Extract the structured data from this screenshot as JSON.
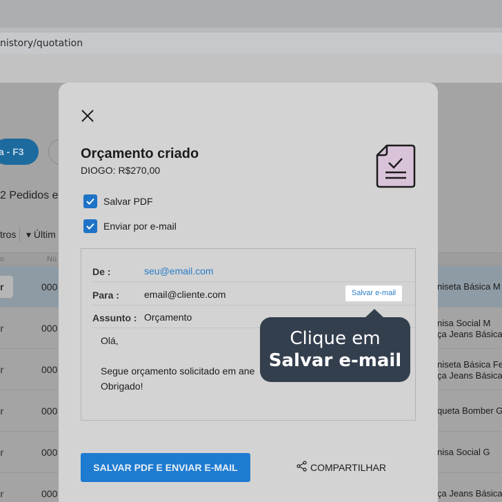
{
  "browser": {
    "url_fragment": "nistory/quotation"
  },
  "background": {
    "primary_button_label": "a - F3",
    "list_title": "2 Pedidos e",
    "filters_label": "tros",
    "sort_label": "Últim",
    "header_cols": [
      "o",
      "Nú"
    ],
    "rows": [
      {
        "c1": "r",
        "c2": "000",
        "c3": [
          "niseta Básica M"
        ],
        "selected": true
      },
      {
        "c1": "r",
        "c2": "000",
        "c3": [
          "nisa Social M",
          "ça Jeans Básica"
        ]
      },
      {
        "c1": "r",
        "c2": "000",
        "c3": [
          "niseta Básica Fe",
          "ça Jeans Básica"
        ]
      },
      {
        "c1": "r",
        "c2": "000",
        "c3": [
          "queta Bomber G"
        ]
      },
      {
        "c1": "r",
        "c2": "000",
        "c3": [
          "nisa Social G"
        ]
      },
      {
        "c1": "r",
        "c2": "000",
        "c3": [
          "ça Jeans Básica"
        ]
      }
    ]
  },
  "modal": {
    "title": "Orçamento criado",
    "subtitle": "DIOGO: R$270,00",
    "checkbox_pdf": "Salvar PDF",
    "checkbox_email": "Enviar por e-mail",
    "email": {
      "from_label": "De :",
      "from_value": "seu@email.com",
      "to_label": "Para :",
      "to_value": "email@cliente.com",
      "save_email_label": "Salvar e-mail",
      "subject_label": "Assunto :",
      "subject_value": "Orçamento",
      "body": "Olá,\n\nSegue orçamento solicitado em ane\nObrigado!"
    },
    "primary_button": "SALVAR PDF E ENVIAR E-MAIL",
    "share_button": "COMPARTILHAR"
  },
  "tooltip": {
    "line1": "Clique em",
    "line2": "Salvar e-mail"
  },
  "colors": {
    "accent": "#1e7bd0",
    "link": "#2a7cc7",
    "tooltip_bg": "#343f4e",
    "doc_icon_fill": "#d9c3d9"
  }
}
